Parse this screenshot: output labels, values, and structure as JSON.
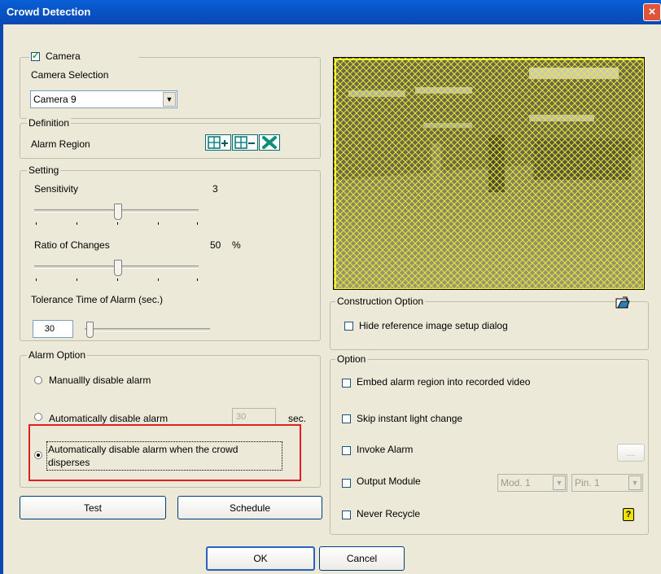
{
  "window": {
    "title": "Crowd Detection",
    "close_glyph": "×"
  },
  "camera": {
    "label": "Camera",
    "checked": true,
    "selection_label": "Camera Selection",
    "selected": "Camera 9"
  },
  "definition": {
    "label": "Definition",
    "alarm_region_label": "Alarm Region",
    "icons": [
      "add-region-icon",
      "remove-region-icon",
      "clear-region-icon"
    ]
  },
  "setting": {
    "label": "Setting",
    "sensitivity": {
      "label": "Sensitivity",
      "value": "3",
      "level": 0.5
    },
    "ratio": {
      "label": "Ratio of Changes",
      "value": "50",
      "unit": "%",
      "level": 0.5
    },
    "tolerance": {
      "label": "Tolerance Time of Alarm (sec.)",
      "value": "30"
    }
  },
  "alarm_option": {
    "label": "Alarm Option",
    "manual": "Manuallly disable alarm",
    "auto": "Automatically disable alarm",
    "auto_value": "30",
    "auto_unit": "sec.",
    "crowd_line1": "Automatically disable alarm when the crowd",
    "crowd_line2": "disperses",
    "selected": "crowd"
  },
  "buttons": {
    "test": "Test",
    "schedule": "Schedule",
    "ok": "OK",
    "cancel": "Cancel",
    "browse": "...."
  },
  "construction": {
    "label": "Construction Option",
    "hide_ref": "Hide reference image setup dialog",
    "icon": "open-folder-icon"
  },
  "option": {
    "label": "Option",
    "embed": "Embed alarm region into recorded video",
    "skip": "Skip instant light change",
    "invoke": "Invoke Alarm",
    "output": "Output Module",
    "module": "Mod. 1",
    "pin": "Pin. 1",
    "recycle": "Never Recycle",
    "help_icon": "help-icon"
  },
  "colors": {
    "title_bar": "#0a5fd8",
    "dialog": "#ece9d8",
    "highlight": "#e02020",
    "mesh": "#f2f224"
  }
}
